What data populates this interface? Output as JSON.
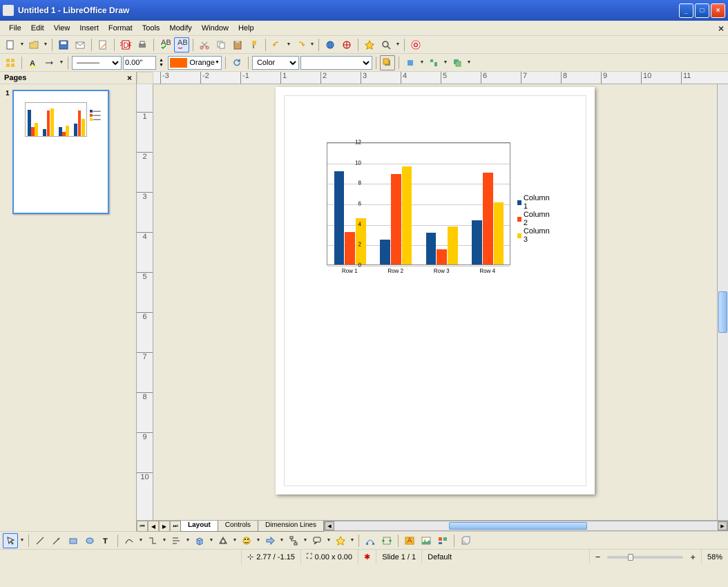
{
  "window": {
    "title": "Untitled 1 - LibreOffice Draw"
  },
  "menu": {
    "file": "File",
    "edit": "Edit",
    "view": "View",
    "insert": "Insert",
    "format": "Format",
    "tools": "Tools",
    "modify": "Modify",
    "window": "Window",
    "help": "Help"
  },
  "toolbar2": {
    "linewidth": "0.00\"",
    "linecolor_label": "Orange",
    "fillmode": "Color"
  },
  "panel": {
    "pages_title": "Pages",
    "page_number": "1"
  },
  "tabs": {
    "layout": "Layout",
    "controls": "Controls",
    "dimension": "Dimension Lines"
  },
  "status": {
    "pos": "2.77 / -1.15",
    "size": "0.00 x 0.00",
    "slide": "Slide 1 / 1",
    "style": "Default",
    "zoom": "58%"
  },
  "chart_data": {
    "type": "bar",
    "categories": [
      "Row 1",
      "Row 2",
      "Row 3",
      "Row 4"
    ],
    "series": [
      {
        "name": "Column 1",
        "values": [
          9.1,
          2.4,
          3.1,
          4.3
        ],
        "color": "#134e8f"
      },
      {
        "name": "Column 2",
        "values": [
          3.2,
          8.8,
          1.5,
          9.0
        ],
        "color": "#ff4a12"
      },
      {
        "name": "Column 3",
        "values": [
          4.5,
          9.6,
          3.7,
          6.1
        ],
        "color": "#ffcc00"
      }
    ],
    "ylim": [
      0,
      12
    ],
    "yticks": [
      0,
      2,
      4,
      6,
      8,
      10,
      12
    ],
    "legend": [
      "Column 1",
      "Column 2",
      "Column 3"
    ]
  },
  "ruler_h": [
    "-3",
    "-2",
    "-1",
    "1",
    "2",
    "3",
    "4",
    "5",
    "6",
    "7",
    "8",
    "9",
    "10",
    "11"
  ],
  "ruler_v": [
    "1",
    "2",
    "3",
    "4",
    "5",
    "6",
    "7",
    "8",
    "9",
    "10"
  ]
}
